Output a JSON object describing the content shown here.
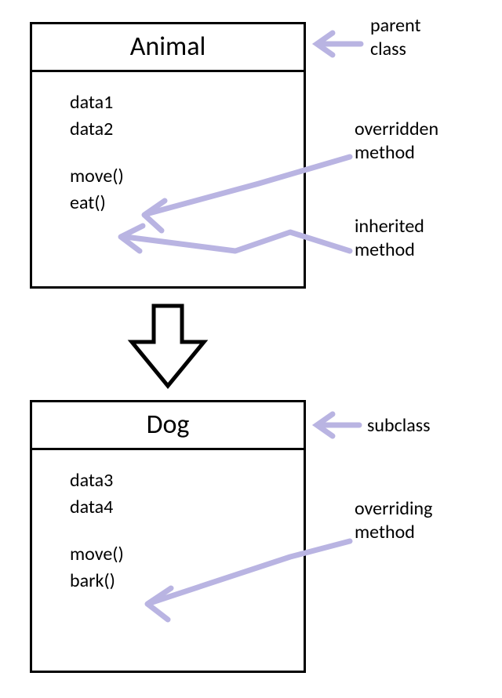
{
  "diagram": {
    "parent": {
      "title": "Animal",
      "data": [
        "data1",
        "data2"
      ],
      "methods": [
        "move()",
        "eat()"
      ]
    },
    "child": {
      "title": "Dog",
      "data": [
        "data3",
        "data4"
      ],
      "methods": [
        "move()",
        "bark()"
      ]
    }
  },
  "annotations": {
    "parent_class_l1": "parent",
    "parent_class_l2": "class",
    "overridden_l1": "overridden",
    "overridden_l2": "method",
    "inherited_l1": "inherited",
    "inherited_l2": "method",
    "subclass": "subclass",
    "overriding_l1": "overriding",
    "overriding_l2": "method"
  },
  "colors": {
    "arrow": "#b9b4e2"
  }
}
